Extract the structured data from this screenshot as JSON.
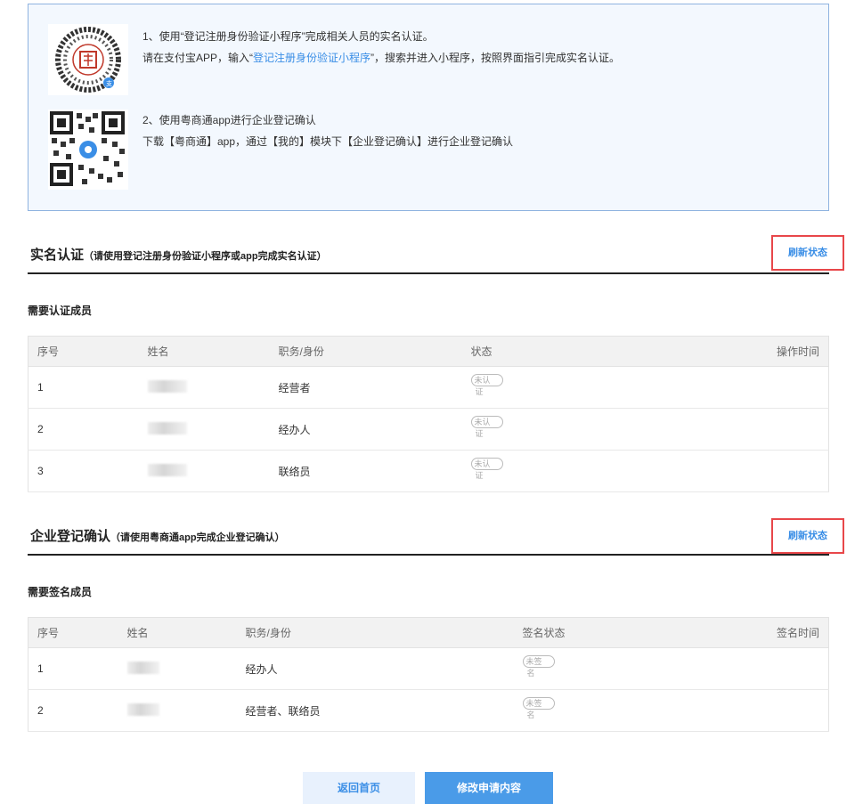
{
  "info": {
    "step1_line1": "1、使用“登记注册身份验证小程序”完成相关人员的实名认证。",
    "step1_line2_pre": "请在支付宝APP，输入“",
    "step1_line2_link": "登记注册身份验证小程序",
    "step1_line2_post": "”，搜索并进入小程序，按照界面指引完成实名认证。",
    "step2_line1": "2、使用粤商通app进行企业登记确认",
    "step2_line2": "下载【粤商通】app，通过【我的】模块下【企业登记确认】进行企业登记确认"
  },
  "realname": {
    "title": "实名认证",
    "note": "（请使用登记注册身份验证小程序或app完成实名认证）",
    "refresh_label": "刷新状态",
    "subtitle": "需要认证成员",
    "columns": [
      "序号",
      "姓名",
      "职务/身份",
      "状态",
      "操作时间"
    ],
    "rows": [
      {
        "no": "1",
        "role": "经营者",
        "status_a": "未认",
        "status_b": "证"
      },
      {
        "no": "2",
        "role": "经办人",
        "status_a": "未认",
        "status_b": "证"
      },
      {
        "no": "3",
        "role": "联络员",
        "status_a": "未认",
        "status_b": "证"
      }
    ]
  },
  "confirm": {
    "title": "企业登记确认",
    "note": "（请使用粤商通app完成企业登记确认）",
    "refresh_label": "刷新状态",
    "subtitle": "需要签名成员",
    "columns": [
      "序号",
      "姓名",
      "职务/身份",
      "签名状态",
      "签名时间"
    ],
    "rows": [
      {
        "no": "1",
        "role": "经办人",
        "status_a": "未签",
        "status_b": "名"
      },
      {
        "no": "2",
        "role": "经营者、联络员",
        "status_a": "未签",
        "status_b": "名"
      }
    ]
  },
  "footer": {
    "home_label": "返回首页",
    "edit_label": "修改申请内容"
  },
  "colors": {
    "accent": "#3a8ee6",
    "highlight_border": "#e8474a"
  }
}
